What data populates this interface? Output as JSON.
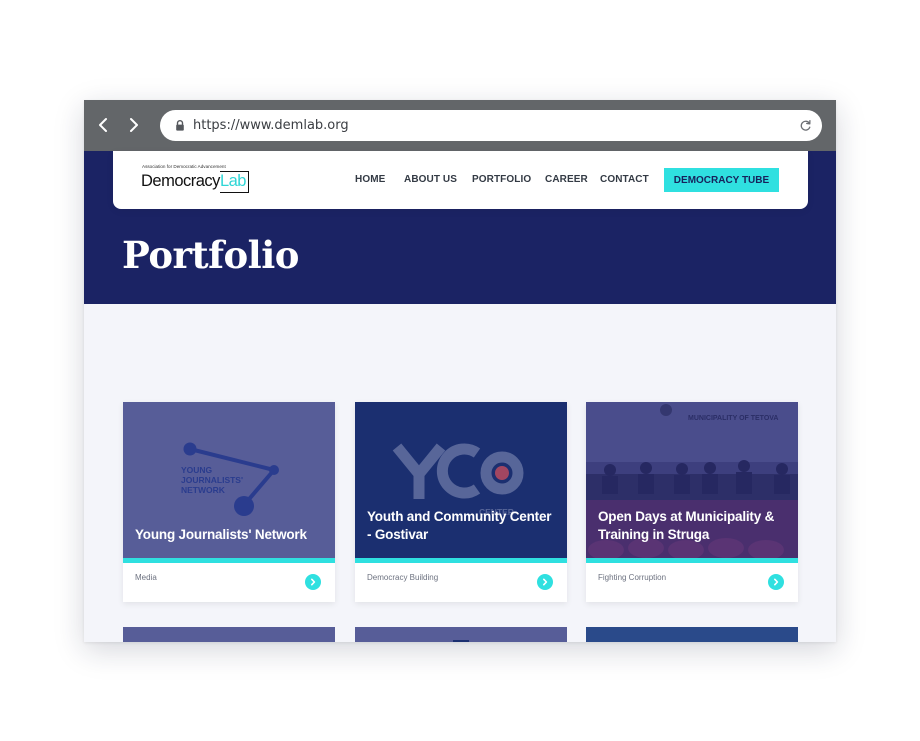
{
  "browser": {
    "url": "https://www.demlab.org",
    "back_icon": "chevron-left-icon",
    "forward_icon": "chevron-right-icon",
    "lock_icon": "lock-icon",
    "reload_icon": "reload-icon"
  },
  "site": {
    "logo": {
      "tagline": "Association for Democratic Advancement",
      "name_part1": "Democracy",
      "name_part2": "Lab"
    },
    "nav": [
      {
        "label": "HOME"
      },
      {
        "label": "ABOUT US"
      },
      {
        "label": "PORTFOLIO"
      },
      {
        "label": "CAREER"
      },
      {
        "label": "CONTACT"
      }
    ],
    "cta_label": "DEMOCRACY TUBE"
  },
  "page": {
    "title": "Portfolio"
  },
  "cards": [
    {
      "title": "Young Journalists' Network",
      "category": "Media",
      "image_text": [
        "YOUNG",
        "JOURNALISTS'",
        "NETWORK"
      ]
    },
    {
      "title": "Youth and Community Center - Gostivar",
      "category": "Democracy Building",
      "image_text": [
        "YCC",
        "CENTER"
      ]
    },
    {
      "title": "Open Days at Municipality & Training in Struga",
      "category": "Fighting Corruption",
      "image_text": [
        "MUNICIPALITY OF TETOVA"
      ]
    }
  ],
  "colors": {
    "navy": "#1b2364",
    "accent": "#2fe0e0",
    "browser_bar": "#636669",
    "page_bg": "#f4f5fa"
  }
}
